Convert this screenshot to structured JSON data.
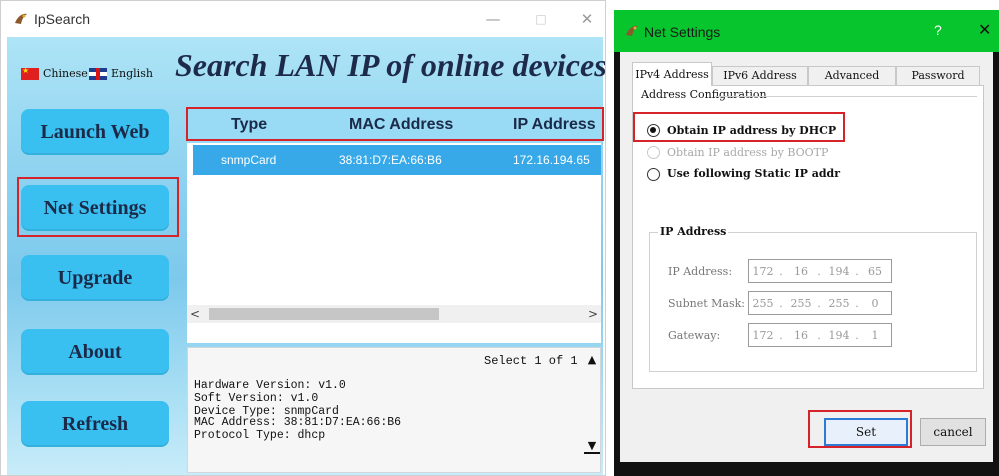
{
  "ipsearch": {
    "title": "IpSearch",
    "window_buttons": {
      "minimize": "—",
      "maximize": "□",
      "close": "✕"
    },
    "languages": {
      "chinese": "Chinese",
      "english": "English"
    },
    "headline": "Search LAN IP of online devices",
    "sidebar": {
      "launch_web": "Launch Web",
      "net_settings": "Net Settings",
      "upgrade": "Upgrade",
      "about": "About",
      "refresh": "Refresh"
    },
    "table": {
      "columns": [
        "Type",
        "MAC Address",
        "IP Address"
      ],
      "rows": [
        {
          "type": "snmpCard",
          "mac": "38:81:D7:EA:66:B6",
          "ip": "172.16.194.65"
        }
      ]
    },
    "scroll": {
      "left": "<",
      "right": ">"
    },
    "details": {
      "select_status": "Select 1 of 1",
      "hardware_version": "Hardware Version: v1.0",
      "soft_version": "Soft Version: v1.0",
      "device_type": "Device Type: snmpCard",
      "mac_address": "MAC Address:  38:81:D7:EA:66:B6",
      "protocol_type": "Protocol Type: dhcp"
    },
    "highlight_color": "#d6232a",
    "button_color": "#39bff0"
  },
  "net_settings": {
    "title": "Net Settings",
    "help": "?",
    "close": "✕",
    "tabs": [
      "IPv4 Address",
      "IPv6 Address",
      "Advanced",
      "Password"
    ],
    "active_tab": "IPv4 Address",
    "address_config": {
      "label": "Address Configuration",
      "options": [
        {
          "label": "Obtain IP address by DHCP",
          "selected": true,
          "enabled": true
        },
        {
          "label": "Obtain IP address by BOOTP",
          "selected": false,
          "enabled": false
        },
        {
          "label": "Use following Static IP addr",
          "selected": false,
          "enabled": true
        }
      ]
    },
    "ip_address_group": {
      "label": "IP Address",
      "ip_label": "IP Address:",
      "ip": [
        "172",
        "16",
        "194",
        "65"
      ],
      "mask_label": "Subnet Mask:",
      "mask": [
        "255",
        "255",
        "255",
        "0"
      ],
      "gateway_label": "Gateway:",
      "gateway": [
        "172",
        "16",
        "194",
        "1"
      ]
    },
    "buttons": {
      "set": "Set",
      "cancel": "cancel"
    },
    "titlebar_color": "#07c52d"
  }
}
